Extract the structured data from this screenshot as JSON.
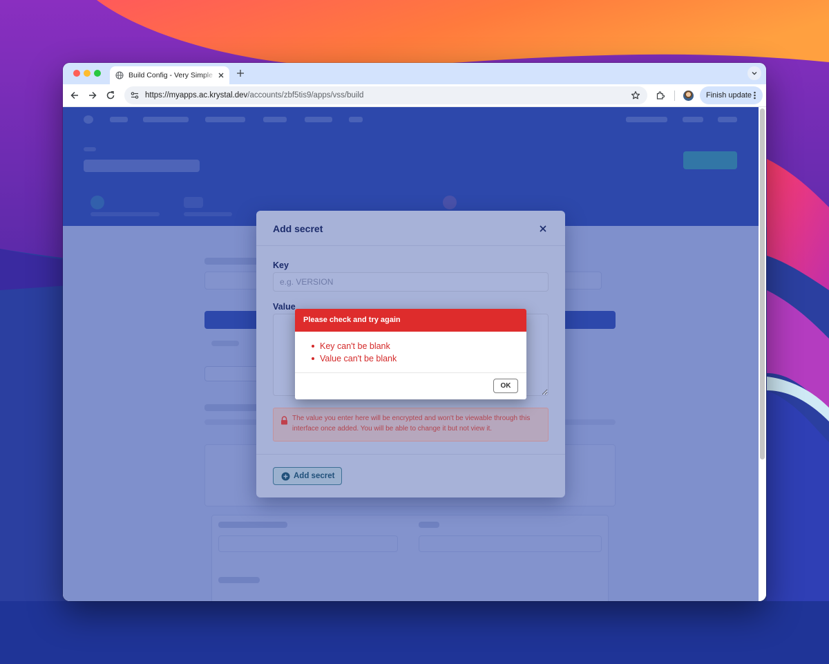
{
  "browser": {
    "tab_title": "Build Config - Very Simple Si",
    "url_host": "https://myapps.ac.krystal.dev",
    "url_path": "/accounts/zbf5tis9/apps/vss/build",
    "update_label": "Finish update"
  },
  "modal": {
    "title": "Add secret",
    "key_label": "Key",
    "key_placeholder": "e.g. VERSION",
    "key_value": "",
    "value_label": "Value",
    "value_value": "",
    "notice_text": "The value you enter here will be encrypted and won't be viewable through this interface once added. You will be able to change it but not view it.",
    "submit_label": "Add secret"
  },
  "alert": {
    "title": "Please check and try again",
    "errors": [
      "Key can't be blank",
      "Value can't be blank"
    ],
    "ok_label": "OK"
  },
  "colors": {
    "alert_header": "#de2c2c",
    "error_text": "#d42a2a",
    "app_header": "#1d3aa6",
    "modal_title": "#1b2b6b"
  }
}
